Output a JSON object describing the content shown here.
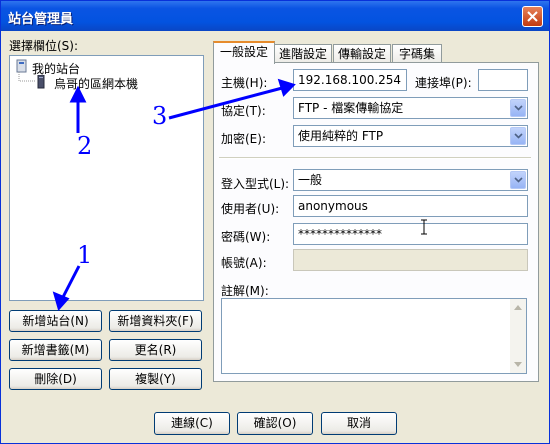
{
  "window": {
    "title": "站台管理員"
  },
  "left": {
    "tree_label": "選擇欄位(S):",
    "tree": {
      "root": "我的站台",
      "child": "烏哥的區網本機"
    },
    "buttons": {
      "new_site": "新增站台(N)",
      "new_folder": "新增資料夾(F)",
      "new_bookmark": "新增書籤(M)",
      "rename": "更名(R)",
      "delete": "刪除(D)",
      "copy": "複製(Y)"
    }
  },
  "tabs": [
    "一般設定",
    "進階設定",
    "傳輸設定",
    "字碼集"
  ],
  "general": {
    "host_label": "主機(H):",
    "host_value": "192.168.100.254",
    "port_label": "連接埠(P):",
    "port_value": "",
    "protocol_label": "協定(T):",
    "protocol_value": "FTP - 檔案傳輸協定",
    "encryption_label": "加密(E):",
    "encryption_value": "使用純粹的 FTP",
    "logon_type_label": "登入型式(L):",
    "logon_type_value": "一般",
    "user_label": "使用者(U):",
    "user_value": "anonymous",
    "password_label": "密碼(W):",
    "password_value": "**************",
    "account_label": "帳號(A):",
    "comments_label": "註解(M):"
  },
  "footer": {
    "connect": "連線(C)",
    "ok": "確認(O)",
    "cancel": "取消"
  },
  "annotations": {
    "n1": "1",
    "n2": "2",
    "n3": "3"
  },
  "colors": {
    "title_bar": "#0A54E3",
    "dialog_bg": "#ECE9D8",
    "annotation": "#0000FF",
    "active_tab_accent": "#E68B2C"
  }
}
